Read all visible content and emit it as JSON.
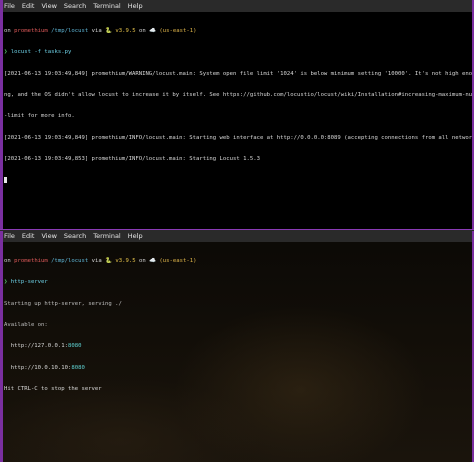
{
  "menu": [
    "File",
    "Edit",
    "View",
    "Search",
    "Terminal",
    "Help"
  ],
  "top": {
    "prompt": {
      "prefix": "on ",
      "host": "promethium",
      "path": " /tmp/locust",
      "via": " via ",
      "python": "🐍 v3.9.5",
      "on": " on ",
      "aws": "☁️ (us-east-1)"
    },
    "command_arrow": "❯",
    "command": " locust -f tasks.py",
    "log": [
      "[2021-06-13 19:03:49,849] promethium/WARNING/locust.main: System open file limit '1024' is below minimum setting '10000'. It's not high enough for load testi",
      "ng, and the OS didn't allow locust to increase it by itself. See https://github.com/locustio/locust/wiki/Installation#increasing-maximum-number-of-open-files",
      "-limit for more info.",
      "[2021-06-13 19:03:49,849] promethium/INFO/locust.main: Starting web interface at http://0.0.0.0:8089 (accepting connections from all network interfaces)",
      "[2021-06-13 19:03:49,853] promethium/INFO/locust.main: Starting Locust 1.5.3"
    ]
  },
  "bottom": {
    "prompt": {
      "prefix": "on ",
      "host": "promethium",
      "path": " /tmp/locust",
      "via": " via ",
      "python": "🐍 v3.9.5",
      "on": " on ",
      "aws": "☁️ (us-east-1)"
    },
    "command_arrow": "❯",
    "command": " http-server",
    "output": {
      "starting": "Starting up http-server, serving ./",
      "available": "Available on:",
      "addr1_prefix": "  http://127.0.0.1:",
      "addr1_port": "8080",
      "addr2_prefix": "  http://10.0.10.10:",
      "addr2_port": "8080",
      "stop": "Hit CTRL-C to stop the server"
    }
  }
}
